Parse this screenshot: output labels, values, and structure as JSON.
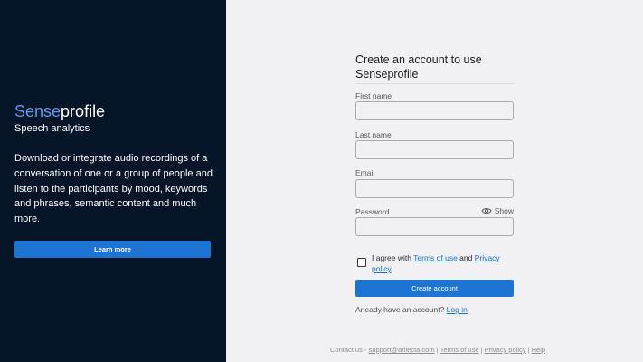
{
  "left_panel": {
    "brand_accent": "Sense",
    "brand_rest": "profile",
    "tagline": "Speech analytics",
    "description": "Download or integrate audio recordings of a conversation of one or a group of people and listen to the participants by mood, keywords and phrases, semantic content and much more.",
    "learn_more_label": "Learn more"
  },
  "form": {
    "title": "Create an account to use Senseprofile",
    "first_name_label": "First name",
    "first_name_value": "",
    "last_name_label": "Last name",
    "last_name_value": "",
    "email_label": "Email",
    "email_value": "",
    "password_label": "Password",
    "password_value": "",
    "show_label": "Show",
    "agree_prefix": "I agree with ",
    "terms_link": "Terms of use",
    "agree_and": " and ",
    "privacy_link": "Privacy policy",
    "agreed": false,
    "create_label": "Create account",
    "have_account": "Arleady have an account? ",
    "login_link": "Log in"
  },
  "footer": {
    "contact_prefix": "Contact us - ",
    "email": "support@arllecta.com",
    "sep1": " | ",
    "terms": "Terms of use",
    "sep2": " | ",
    "privacy": "Privacy policy",
    "sep3": " | ",
    "help": "Help"
  },
  "colors": {
    "left_bg": "#061527",
    "accent": "#5b9bf0",
    "button": "#1e74d2",
    "page_bg": "#f1f1f3",
    "link": "#1f6fc7"
  },
  "icons": {
    "password_toggle": "eye-icon"
  }
}
